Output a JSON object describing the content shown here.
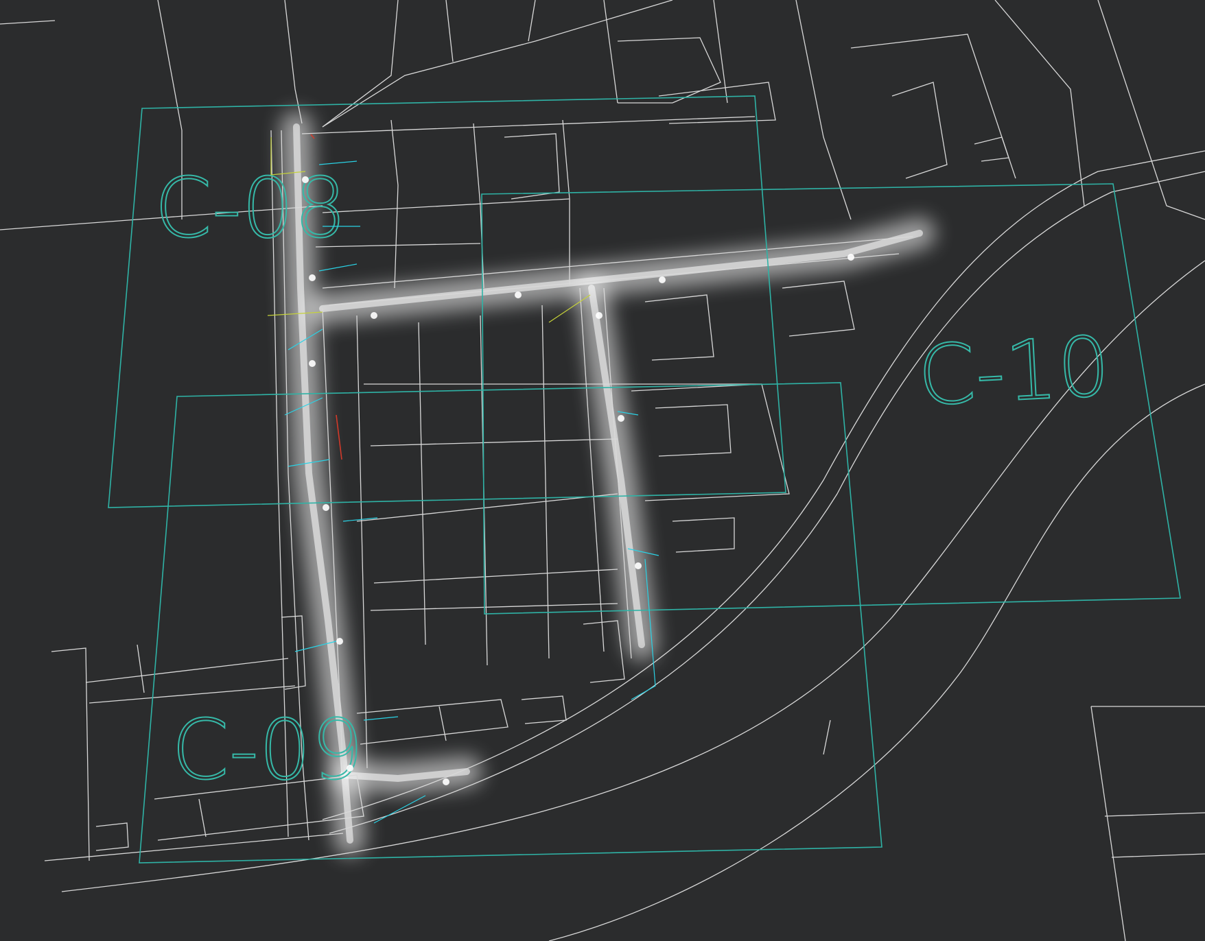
{
  "map": {
    "background_color": "#2b2c2d",
    "line_color": "#d9d9d9",
    "sheet_frame_color": "#2fb3a6",
    "glow_color": "#ffffff",
    "annotation_color": "#2ad3e6",
    "highlight_annotation_color": "#c6d23a"
  },
  "sheet_labels": {
    "c08": "C-08",
    "c09": "C-09",
    "c10": "C-10"
  }
}
